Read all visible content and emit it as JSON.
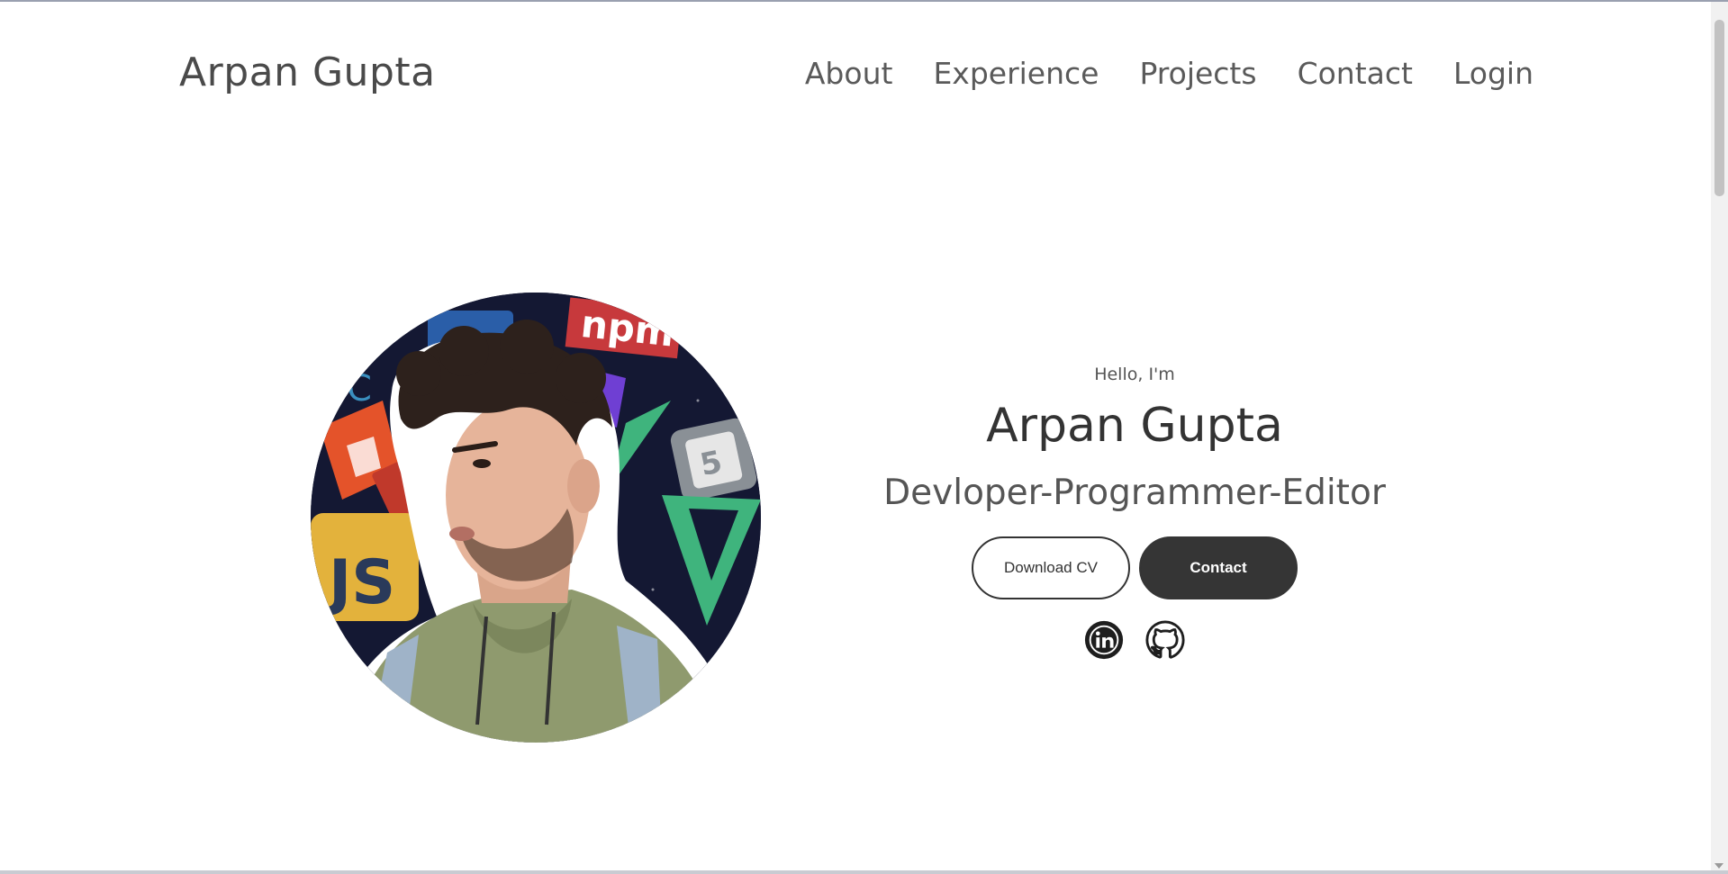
{
  "header": {
    "logo": "Arpan Gupta",
    "nav": [
      "About",
      "Experience",
      "Projects",
      "Contact",
      "Login"
    ]
  },
  "hero": {
    "greeting": "Hello, I'm",
    "name": "Arpan Gupta",
    "role": "Devloper-Programmer-Editor",
    "download_cv_label": "Download CV",
    "contact_label": "Contact",
    "social_icons": [
      "linkedin-icon",
      "github-icon"
    ]
  },
  "profile_image": {
    "background_logos": [
      "JS",
      "npm",
      "html5-icon",
      "vue-icon",
      "c-icon"
    ]
  },
  "colors": {
    "text_dark": "#333333",
    "button_dark": "#353535",
    "photo_bg": "#141833"
  }
}
